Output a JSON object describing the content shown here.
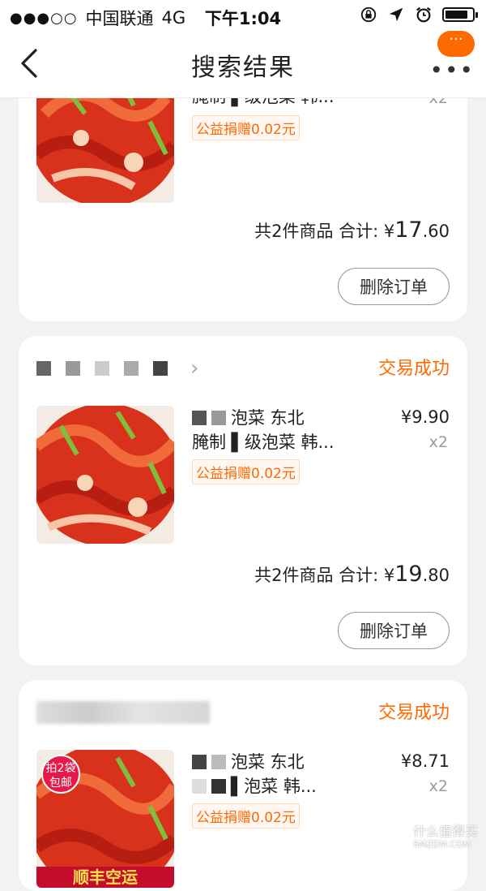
{
  "status_bar": {
    "signal": "●●●○○",
    "carrier": "中国联通",
    "network": "4G",
    "time": "下午1:04",
    "battery_level": 0.85
  },
  "nav": {
    "title": "搜索结果",
    "more_bubble": "···",
    "more_dots": "•••"
  },
  "orders": [
    {
      "name_line2": "腌制 ▌级泡菜 韩...",
      "qty": "x2",
      "charity": "公益捐赠0.02元",
      "summary_prefix": "共2件商品 合计: ¥",
      "total_int": "17",
      "total_dec": ".60",
      "delete_label": "删除订单"
    },
    {
      "status": "交易成功",
      "name_line1": "泡菜 东北",
      "name_line2": "腌制 ▌级泡菜 韩...",
      "price": "¥9.90",
      "qty": "x2",
      "charity": "公益捐赠0.02元",
      "summary_prefix": "共2件商品 合计: ¥",
      "total_int": "19",
      "total_dec": ".80",
      "delete_label": "删除订单"
    },
    {
      "status": "交易成功",
      "name_line1": "泡菜 东北",
      "name_line2": "▌泡菜 韩...",
      "price": "¥8.71",
      "qty": "x2",
      "charity": "公益捐赠0.02元",
      "badge": "拍2袋\n包邮",
      "banner": "顺丰空运"
    }
  ],
  "watermark": {
    "text": "什么值得买",
    "sub": "SMZDM.COM"
  },
  "colors": {
    "accent": "#ff6a00",
    "background": "#f2f2f2"
  },
  "icons": [
    "back-arrow-icon",
    "lock-rotation-icon",
    "location-arrow-icon",
    "alarm-icon",
    "battery-icon",
    "chevron-right-icon",
    "more-icon"
  ]
}
